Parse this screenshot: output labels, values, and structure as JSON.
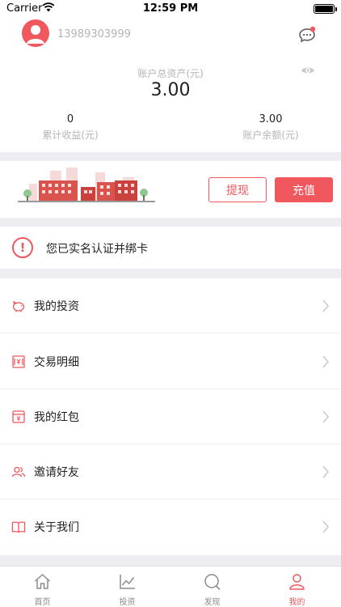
{
  "status_bar": {
    "carrier": "Carrier",
    "time": "12:59 PM"
  },
  "account": {
    "phone": "13989303999",
    "total_assets_label": "账户总资产(元)",
    "total_assets_value": "3.00",
    "cumulative_income_value": "0",
    "cumulative_income_label": "累计收益(元)",
    "balance_value": "3.00",
    "balance_label": "账户余额(元)"
  },
  "actions": {
    "withdraw_label": "提现",
    "recharge_label": "充值"
  },
  "notice": {
    "text": "您已实名认证并绑卡"
  },
  "menu": {
    "items": [
      {
        "label": "我的投资",
        "icon": "piggy-bank-icon"
      },
      {
        "label": "交易明细",
        "icon": "ledger-icon"
      },
      {
        "label": "我的红包",
        "icon": "red-envelope-icon"
      },
      {
        "label": "邀请好友",
        "icon": "friends-icon"
      },
      {
        "label": "关于我们",
        "icon": "book-icon"
      }
    ]
  },
  "tabbar": {
    "tabs": [
      {
        "label": "首页",
        "icon": "home-icon"
      },
      {
        "label": "投资",
        "icon": "chart-icon"
      },
      {
        "label": "发现",
        "icon": "discover-icon"
      },
      {
        "label": "我的",
        "icon": "user-icon",
        "active": true
      }
    ]
  },
  "colors": {
    "accent": "#f0585e",
    "muted_text": "#b4b4b4",
    "separator": "#eeedf2"
  }
}
